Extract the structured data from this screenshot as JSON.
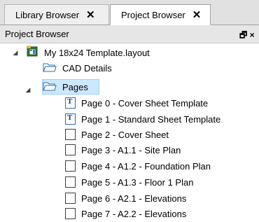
{
  "tabs": [
    {
      "label": "Library Browser",
      "close": "✕"
    },
    {
      "label": "Project Browser",
      "close": "✕"
    }
  ],
  "pane": {
    "title": "Project Browser",
    "float_glyph": "🗗 ×"
  },
  "tree": {
    "root": {
      "label": "My 18x24 Template.layout",
      "expand": "◢"
    },
    "cad": {
      "label": "CAD Details"
    },
    "pages": {
      "label": "Pages",
      "expand": "◢"
    },
    "page_items": [
      {
        "label": "Page 0 - Cover Sheet Template",
        "icon": "T"
      },
      {
        "label": "Page 1 - Standard Sheet Template",
        "icon": "T"
      },
      {
        "label": "Page 2 - Cover Sheet",
        "icon": ""
      },
      {
        "label": "Page 3 - A1.1 - Site Plan",
        "icon": ""
      },
      {
        "label": "Page 4 - A1.2 - Foundation Plan",
        "icon": ""
      },
      {
        "label": "Page 5 - A1.3 - Floor 1 Plan",
        "icon": ""
      },
      {
        "label": "Page 6 - A2.1 - Elevations",
        "icon": ""
      },
      {
        "label": "Page 7 - A2.2 - Elevations",
        "icon": ""
      }
    ]
  }
}
